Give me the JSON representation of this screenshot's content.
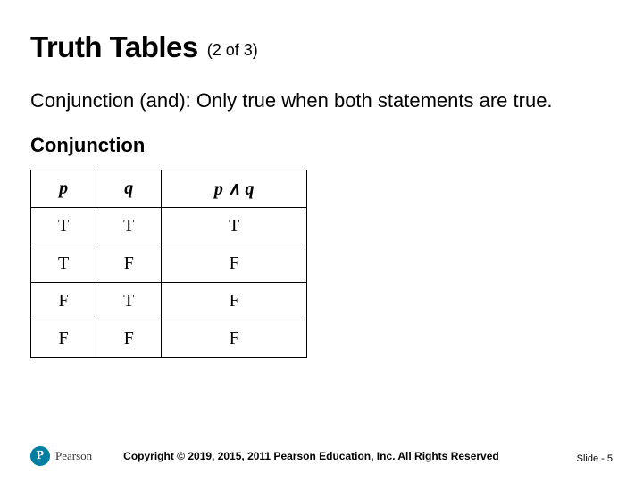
{
  "title": "Truth Tables",
  "counter": "(2 of 3)",
  "description": "Conjunction (and): Only true when both statements are true.",
  "subheading": "Conjunction",
  "table": {
    "headers": {
      "p": "p",
      "q": "q",
      "pq": "p ∧ q"
    },
    "rows": [
      {
        "p": "T",
        "q": "T",
        "pq": "T"
      },
      {
        "p": "T",
        "q": "F",
        "pq": "F"
      },
      {
        "p": "F",
        "q": "T",
        "pq": "F"
      },
      {
        "p": "F",
        "q": "F",
        "pq": "F"
      }
    ]
  },
  "footer": {
    "brand_initial": "P",
    "brand": "Pearson",
    "copyright": "Copyright © 2019, 2015, 2011 Pearson Education, Inc. All Rights Reserved",
    "slide": "Slide - 5"
  }
}
